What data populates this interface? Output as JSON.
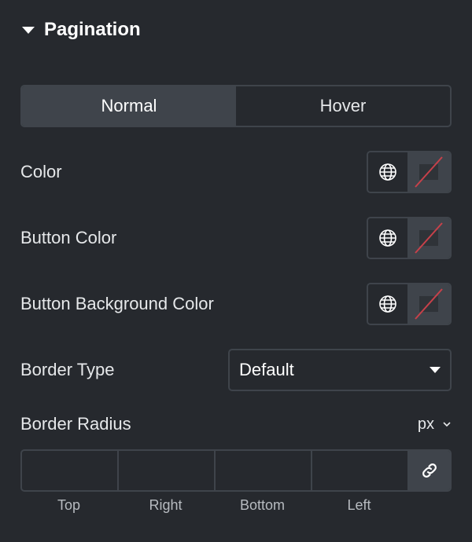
{
  "section": {
    "title": "Pagination"
  },
  "tabs": [
    {
      "label": "Normal",
      "active": true
    },
    {
      "label": "Hover",
      "active": false
    }
  ],
  "color_rows": [
    {
      "label": "Color"
    },
    {
      "label": "Button Color"
    },
    {
      "label": "Button Background Color"
    }
  ],
  "border_type": {
    "label": "Border Type",
    "value": "Default"
  },
  "border_radius": {
    "label": "Border Radius",
    "unit": "px",
    "sides": [
      "Top",
      "Right",
      "Bottom",
      "Left"
    ]
  },
  "colors": {
    "background": "#26292e",
    "control": "#3f444b",
    "slash": "#c7414a"
  },
  "icons": [
    "caret-down-icon",
    "globe-icon",
    "empty-color-icon",
    "chevron-down-icon",
    "link-icon"
  ]
}
